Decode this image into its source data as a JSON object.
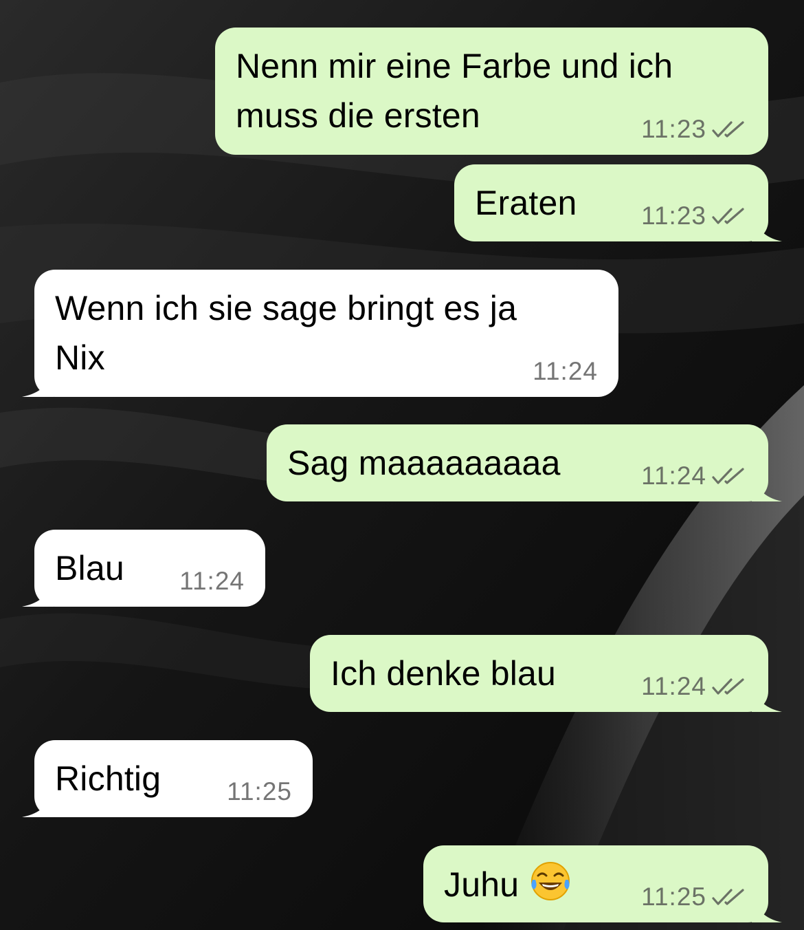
{
  "colors": {
    "outgoing_bubble": "#dbf8c6",
    "incoming_bubble": "#ffffff",
    "read_ticks": "#6b7266"
  },
  "messages": [
    {
      "direction": "outgoing",
      "text": "Nenn mir eine Farbe und ich\nmuss die ersten",
      "time": "11:23",
      "status": "read-double-check-icon"
    },
    {
      "direction": "outgoing",
      "text": "Eraten",
      "time": "11:23",
      "status": "read-double-check-icon"
    },
    {
      "direction": "incoming",
      "text": "Wenn ich sie sage bringt es ja\nNix",
      "time": "11:24"
    },
    {
      "direction": "outgoing",
      "text": "Sag maaaaaaaaa",
      "time": "11:24",
      "status": "read-double-check-icon"
    },
    {
      "direction": "incoming",
      "text": "Blau",
      "time": "11:24"
    },
    {
      "direction": "outgoing",
      "text": "Ich denke blau",
      "time": "11:24",
      "status": "read-double-check-icon"
    },
    {
      "direction": "incoming",
      "text": "Richtig",
      "time": "11:25"
    },
    {
      "direction": "outgoing",
      "text": "Juhu",
      "emoji": "face-with-tears-of-joy-emoji",
      "time": "11:25",
      "status": "read-double-check-icon"
    }
  ]
}
